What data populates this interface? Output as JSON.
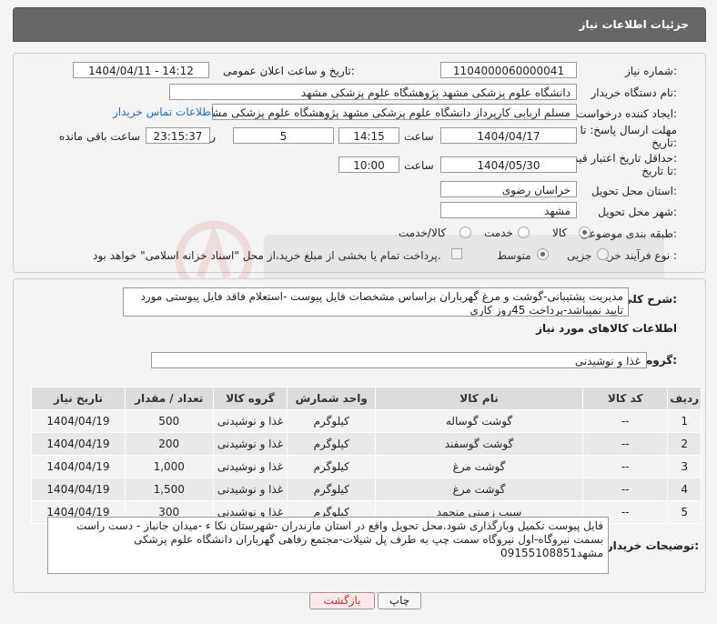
{
  "header": {
    "title": "جزئیات اطلاعات نیاز"
  },
  "form": {
    "need_number_label": "شماره نیاز:",
    "need_number": "1104000060000041",
    "announce_label": "تاریخ و ساعت اعلان عمومی:",
    "announce_value": "1404/04/11 - 14:12",
    "buyer_org_label": "نام دستگاه خریدار:",
    "buyer_org": "دانشگاه علوم پزشکی مشهد   پژوهشگاه علوم پزشکی مشهد",
    "requester_label": "ایجاد کننده درخواست:",
    "requester": "مسلم اربابی کارپرداز دانشگاه علوم پزشکی مشهد   پژوهشگاه علوم پزشکی مشهد",
    "contact_link": "اطلاعات تماس خریدار",
    "reply_deadline_label_1": "مهلت ارسال پاسخ: تا",
    "reply_deadline_label_2": "تاریخ:",
    "reply_date": "1404/04/17",
    "time_label": "ساعت",
    "reply_time": "14:15",
    "days_value": "5",
    "days_label": "روز و",
    "remaining_time": "23:15:37",
    "remaining_label": "ساعت باقی مانده",
    "price_validity_label_1": "حداقل تاریخ اعتبار قیمت:",
    "price_validity_label_2": "تا تاریخ:",
    "validity_date": "1404/05/30",
    "validity_time": "10:00",
    "province_label": "استان محل تحویل:",
    "province": "خراسان رضوی",
    "city_label": "شهر محل تحویل:",
    "city": "مشهد",
    "category_label": "طبقه بندی موضوعی:",
    "category_options": [
      "کالا",
      "خدمت",
      "کالا/خدمت"
    ],
    "process_label": "نوع فرآیند خرید :",
    "process_options": [
      "جزیی",
      "متوسط"
    ],
    "treasury_note": "پرداخت تمام یا بخشی از مبلغ خرید،از محل \"اسناد خزانه اسلامی\" خواهد بود."
  },
  "summary": {
    "label": "شرح کلی نیاز:",
    "text": "مدیریت پشتیبانی-گوشت و مرغ گهرباران براساس مشخصات فایل پیوست -استعلام فاقد فایل پیوستی مورد تایید نمیباشد-پرداخت 45روز کاری"
  },
  "goods": {
    "section_title": "اطلاعات کالاهای مورد نیاز",
    "group_label": "گروه کالا:",
    "group_value": "غذا و نوشیدنی",
    "columns": [
      "ردیف",
      "کد کالا",
      "نام کالا",
      "واحد شمارش",
      "گروه کالا",
      "تعداد / مقدار",
      "تاریخ نیاز"
    ],
    "rows": [
      [
        "1",
        "--",
        "گوشت گوساله",
        "کیلوگرم",
        "غذا و نوشیدنی",
        "500",
        "1404/04/19"
      ],
      [
        "2",
        "--",
        "گوشت گوسفند",
        "کیلوگرم",
        "غذا و نوشیدنی",
        "200",
        "1404/04/19"
      ],
      [
        "3",
        "--",
        "گوشت مرغ",
        "کیلوگرم",
        "غذا و نوشیدنی",
        "1,000",
        "1404/04/19"
      ],
      [
        "4",
        "--",
        "گوشت مرغ",
        "کیلوگرم",
        "غذا و نوشیدنی",
        "1,500",
        "1404/04/19"
      ],
      [
        "5",
        "--",
        "سیب زمینی منجمد",
        "کیلوگرم",
        "غذا و نوشیدنی",
        "300",
        "1404/04/19"
      ]
    ]
  },
  "buyer_notes": {
    "label": "توضیحات خریدار:",
    "text": "فایل پیوست تکمیل وبارگذاری شود.محل تحویل واقع در استان مازندران -شهرستان نکا ء -میدان جانباز - دست راست بسمت نیروگاه-اول نیروگاه سمت چپ به طرف پل شیلات-مجتمع رفاهی گهرباران دانشگاه علوم پزشکی مشهد09155108851"
  },
  "buttons": {
    "print": "چاپ",
    "back": "بازگشت"
  },
  "colors": {
    "header_bg": "#666666",
    "back_button_text": "#cc3333",
    "link": "#2a6fb3"
  }
}
